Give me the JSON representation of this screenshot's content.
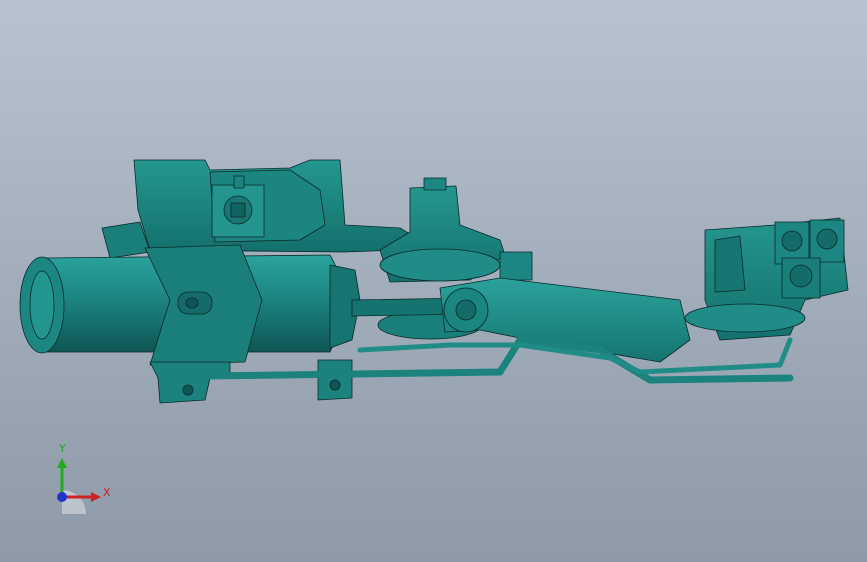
{
  "viewport": {
    "background_top": "#b9c3cf",
    "background_bottom": "#8f9aa9",
    "model_color": "#1f8c88",
    "model_shadow": "#0f5a58",
    "edge_color": "#0a2a2a"
  },
  "triad": {
    "x_label": "X",
    "y_label": "Y",
    "x_color": "#cc2222",
    "y_color": "#22aa22",
    "z_color": "#2233cc"
  }
}
